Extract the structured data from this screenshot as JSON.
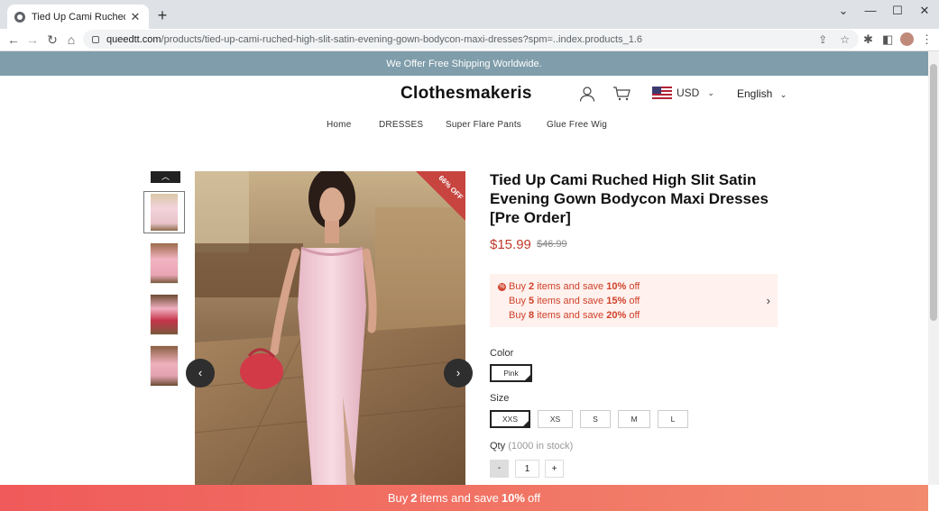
{
  "browser": {
    "tab_title": "Tied Up Cami Ruched High Slit S",
    "url_host": "queedtt.com",
    "url_path": "/products/tied-up-cami-ruched-high-slit-satin-evening-gown-bodycon-maxi-dresses?spm=..index.products_1.6"
  },
  "site": {
    "shipping_banner": "We Offer Free Shipping Worldwide.",
    "logo": "Clothesmakeris",
    "currency": "USD",
    "language": "English",
    "menu": [
      "Home",
      "DRESSES",
      "Super Flare Pants",
      "Glue Free Wig"
    ]
  },
  "product": {
    "badge": "66% OFF",
    "title": "Tied Up Cami Ruched High Slit Satin Evening Gown Bodycon Maxi Dresses [Pre Order]",
    "price": "$15.99",
    "old_price": "$46.99",
    "offers": [
      {
        "pre": "Buy ",
        "qty": "2",
        "mid": " items and save ",
        "pct": "10%",
        "post": " off"
      },
      {
        "pre": "Buy ",
        "qty": "5",
        "mid": " items and save ",
        "pct": "15%",
        "post": " off"
      },
      {
        "pre": "Buy ",
        "qty": "8",
        "mid": " items and save ",
        "pct": "20%",
        "post": " off"
      }
    ],
    "color_label": "Color",
    "colors": [
      "Pink"
    ],
    "size_label": "Size",
    "sizes": [
      "XXS",
      "XS",
      "S",
      "M",
      "L"
    ],
    "qty_label": "Qty",
    "stock": "(1000 in stock)",
    "qty_value": "1",
    "qty_minus": "-",
    "qty_plus": "+"
  },
  "promo_bar": {
    "pre": "Buy",
    "qty": "2",
    "mid": "items and save",
    "pct": "10%",
    "post": "off"
  },
  "colors": {
    "banner": "#7f9daa",
    "accent": "#c0392b",
    "promo_start": "#f05a5a",
    "promo_end": "#f28a6e"
  }
}
